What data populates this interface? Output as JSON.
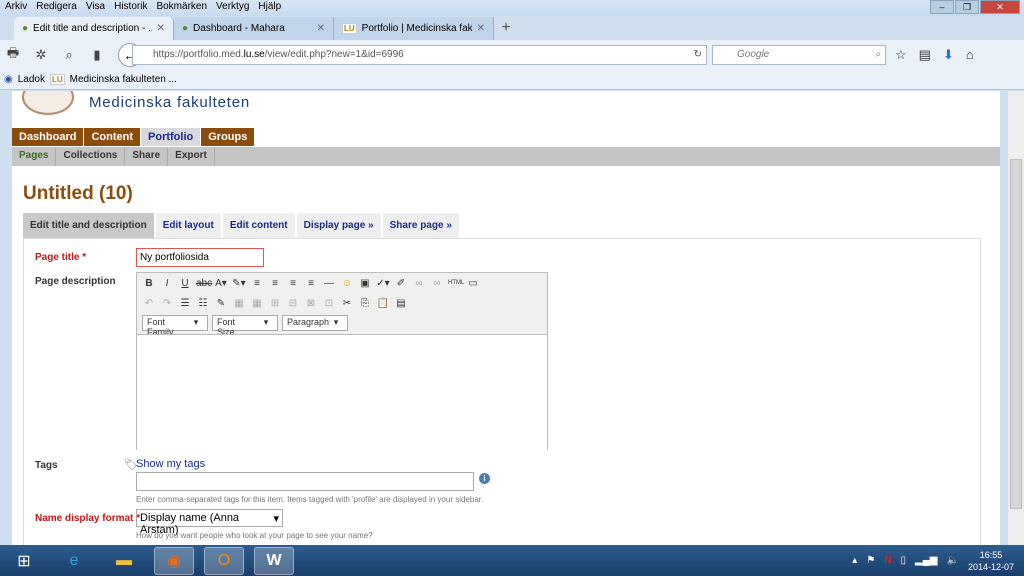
{
  "menu": [
    "Arkiv",
    "Redigera",
    "Visa",
    "Historik",
    "Bokmärken",
    "Verktyg",
    "Hjälp"
  ],
  "tabs": [
    {
      "title": "Edit title and description - ...",
      "active": true
    },
    {
      "title": "Dashboard - Mahara",
      "active": false
    },
    {
      "title": "Portfolio | Medicinska faku...",
      "active": false
    }
  ],
  "url": {
    "pre": "https://portfolio.med.",
    "host": "lu.se",
    "post": "/view/edit.php?new=1&id=6996"
  },
  "search_placeholder": "Google",
  "bookmarks": [
    {
      "label": "Ladok"
    },
    {
      "icon": "LU",
      "label": "Medicinska fakulteten ..."
    }
  ],
  "site_title": "Medicinska fakulteten",
  "main_nav": [
    {
      "label": "Dashboard"
    },
    {
      "label": "Content"
    },
    {
      "label": "Portfolio",
      "selected": true
    },
    {
      "label": "Groups"
    }
  ],
  "sub_nav": [
    {
      "label": "Pages",
      "selected": true
    },
    {
      "label": "Collections"
    },
    {
      "label": "Share"
    },
    {
      "label": "Export"
    }
  ],
  "page_heading": "Untitled (10)",
  "page_tabs": [
    {
      "label": "Edit title and description",
      "selected": true
    },
    {
      "label": "Edit layout"
    },
    {
      "label": "Edit content"
    },
    {
      "label": "Display page »"
    },
    {
      "label": "Share page »"
    }
  ],
  "form": {
    "title_label": "Page title",
    "required": "*",
    "title_value": "Ny portfoliosida",
    "description_label": "Page description",
    "editor": {
      "font_family": "Font Family",
      "font_size": "Font Size",
      "format": "Paragraph"
    },
    "tags_label": "Tags",
    "show_tags": "Show my tags",
    "tags_hint": "Enter comma-separated tags for this item. Items tagged with 'profile' are displayed in your sidebar.",
    "name_format_label": "Name display format",
    "name_format_value": "Display name (Anna Arstam)",
    "name_format_hint": "How do you want people who look at your page to see your name?"
  },
  "clock": {
    "time": "16:55",
    "date": "2014-12-07"
  },
  "colors": {
    "brand_brown": "#8b4d0b",
    "link": "#1a2a8c",
    "required": "#c0161a"
  }
}
